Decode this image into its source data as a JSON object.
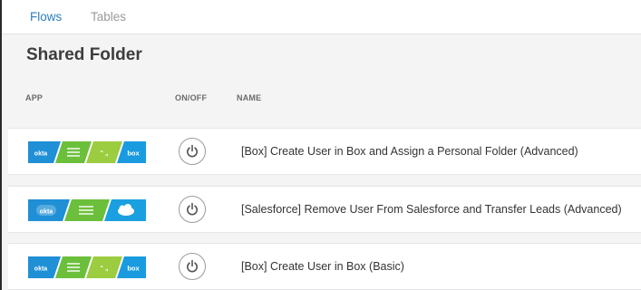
{
  "tabs": [
    {
      "label": "Flows",
      "active": true
    },
    {
      "label": "Tables",
      "active": false
    }
  ],
  "folder": {
    "title": "Shared Folder"
  },
  "columns": {
    "app": "APP",
    "onoff": "ON/OFF",
    "name": "NAME"
  },
  "flows": [
    {
      "name": "[Box] Create User in Box and Assign a Personal Folder (Advanced)",
      "apps": [
        "okta",
        "filter",
        "text",
        "box"
      ],
      "logo_texts": {
        "okta": "okta",
        "box": "box",
        "quote": "“ „"
      },
      "enabled": false
    },
    {
      "name": "[Salesforce] Remove User From Salesforce and Transfer Leads (Advanced)",
      "apps": [
        "okta",
        "filter",
        "salesforce"
      ],
      "logo_texts": {
        "okta": "okta"
      },
      "enabled": false
    },
    {
      "name": "[Box] Create User in Box (Basic)",
      "apps": [
        "okta",
        "filter",
        "text",
        "box"
      ],
      "logo_texts": {
        "okta": "okta",
        "box": "box",
        "quote": "“ „"
      },
      "enabled": false
    }
  ],
  "colors": {
    "okta_blue": "#1f8fd6",
    "filter_green": "#6cbf3b",
    "text_green": "#9ccc3f",
    "box_blue": "#1a9be0",
    "salesforce_blue": "#1aa0e0",
    "active_tab": "#2a7fbf"
  },
  "icons": {
    "power": "power-icon",
    "filter": "filter-icon",
    "cloud": "salesforce-cloud-icon"
  }
}
